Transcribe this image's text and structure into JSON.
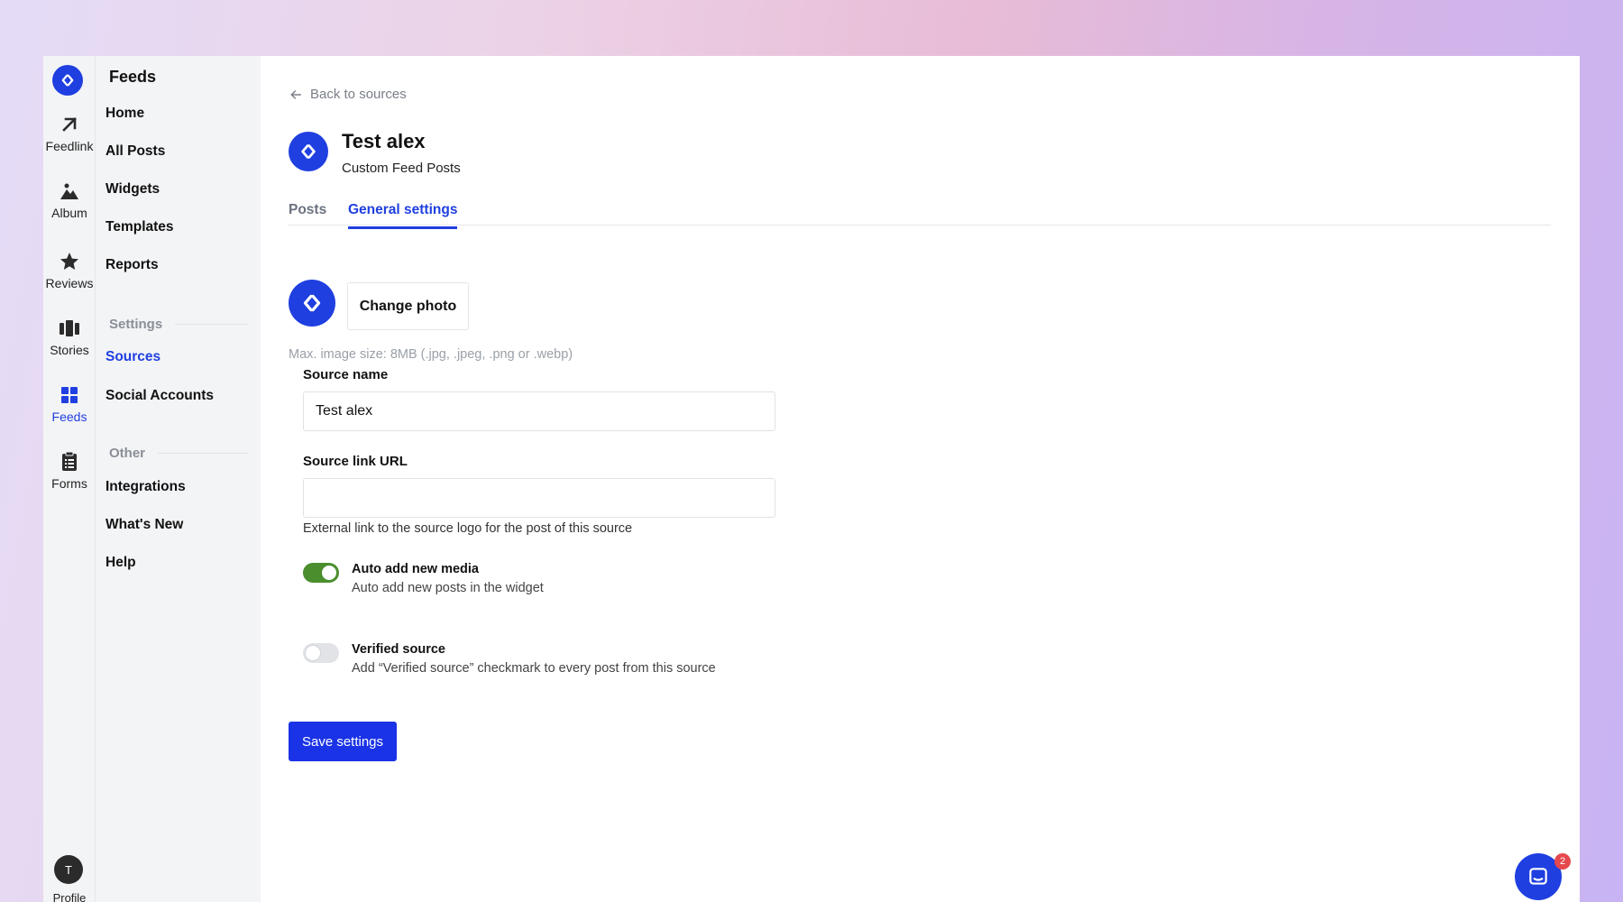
{
  "rail": {
    "logo_icon": "brand-arrows-icon",
    "items": [
      {
        "label": "Feedlink",
        "icon": "arrow-up-right-icon"
      },
      {
        "label": "Album",
        "icon": "mountain-image-icon"
      },
      {
        "label": "Reviews",
        "icon": "star-icon"
      },
      {
        "label": "Stories",
        "icon": "stories-cards-icon"
      },
      {
        "label": "Feeds",
        "icon": "grid-icon",
        "active": true
      },
      {
        "label": "Forms",
        "icon": "clipboard-icon"
      }
    ],
    "avatar_initial": "T",
    "profile_label": "Profile"
  },
  "subnav": {
    "title": "Feeds",
    "items": [
      "Home",
      "All Posts",
      "Widgets",
      "Templates",
      "Reports"
    ],
    "settings_heading": "Settings",
    "settings_items": [
      "Sources",
      "Social Accounts"
    ],
    "other_heading": "Other",
    "other_items": [
      "Integrations",
      "What's New",
      "Help"
    ]
  },
  "main": {
    "back_label": "Back to sources",
    "source_title": "Test alex",
    "source_subtitle": "Custom Feed Posts",
    "tabs": [
      {
        "label": "Posts"
      },
      {
        "label": "General settings",
        "active": true
      }
    ],
    "change_photo_label": "Change photo",
    "image_hint": "Max. image size: 8MB (.jpg, .jpeg, .png or .webp)",
    "source_name": {
      "label": "Source name",
      "value": "Test alex"
    },
    "source_link": {
      "label": "Source link URL",
      "value": "",
      "help": "External link to the source logo for the post of this source"
    },
    "auto_add": {
      "title": "Auto add new media",
      "desc": "Auto add new posts in the widget",
      "on": true
    },
    "verified": {
      "title": "Verified source",
      "desc": "Add “Verified source” checkmark to every post from this source",
      "on": false
    },
    "save_label": "Save settings"
  },
  "chat": {
    "badge_count": "2",
    "icon": "chat-bubble-icon"
  },
  "colors": {
    "accent": "#1f3fe0",
    "toggle_on": "#4a8e2e",
    "badge": "#e5484d"
  }
}
